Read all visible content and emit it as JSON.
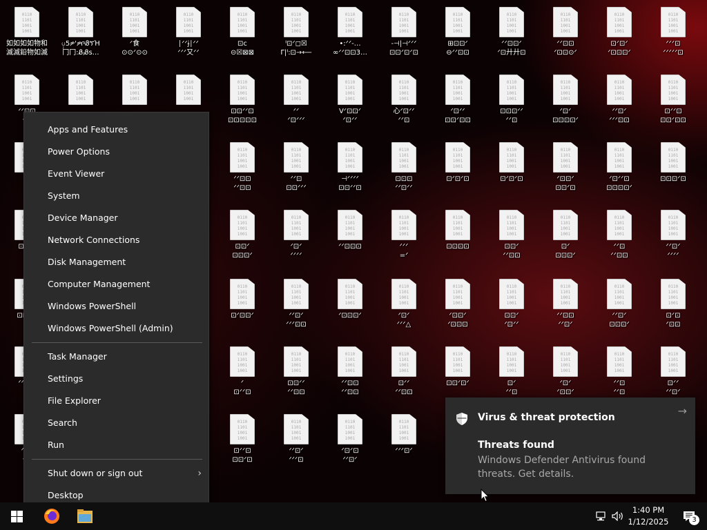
{
  "desktop": {
    "file_glyph": "0110\n1101\n1001\n1001",
    "icons": [
      [
        "如如如如物和\n滅滅鉛物如滅",
        "ၦ5ዎ'ዎቦᏰኘΉ\n冂冂:ᏰⱼᏰs…",
        "ᐟ食\n⊙⊙ᐟ⊙⊙",
        "∣ᐟᐟɉ∣ᐟᐟ\nᐟᐟᐟ又ᐟᐟ",
        "⊡c\n⊝☒⊠⊠",
        "ᑊ⊡ᐟ◻☒\nΓ|ᑊ:⊡→⟵",
        "•:ᐟᐟ-…\n∞ᐟᐟ⊡⊡3…",
        "-⊣|⊣ᐟᐟᐟ\n⊡⊡ᐟ⊡ᐟ⊡",
        "⊞⊡⊡ᐟ\n⊖ᐟᐟ⊡⊡",
        "ᐟᐟ⊡⊡ᐟ\nᐟ⊡廾廾⊡",
        "ᐟᐟ⊡⊡\nᐟ⊡⊡⊙ᐟ",
        "⊡ᐟ⊡ᐟ\nᐟ⊡⊡⊡ᐟ",
        "ᐟᐟᐟ⊡\nᐟᐟᐟᐟᐟ⊡"
      ],
      [
        "ᐟᐟ⊡⊡\nᐟᐟᐟ",
        "",
        "",
        "",
        "⊡⊡ᐟᐟ⊡\n⊡⊡⊡⊡⊡",
        "ᐟᐟ\nᐟ⊡ᐟᐟᐟ",
        "Vᐟ⊡⊡ᐟ\nᐟ⊡ᐟᐟ",
        "心ᐟ⊡ᐟᐟ\nᐟᐟ⊡",
        "ᐟ⊡ᐟᐟ\n⊡⊡ᐟ⊡⊡",
        "⊡⊡⊡ᐟᐟ\nᐟᐟ⊡",
        "ᐟ⊡ᐟ\n⊡⊡⊡⊡ᐟ",
        "ᐟᐟ⊡ᐟ\nᐟᐟᐟ⊡⊡",
        "⊡ᐟᐟ⊡\n⊡⊡ᐟ⊡⊡"
      ],
      [
        "ᐟᐟ\nᐟᐟ",
        "",
        "",
        "",
        "ᐟᐟ⊡⊡\nᐟᐟ⊡⊡",
        "ᐟᐟ⊡\n⊡⊡ᐟᐟᐟ",
        "⊣ᐟᐟᐟᐟ\n⊡⊡ᐟᐟ⊡",
        "⊡⊡⊡\nᐟᐟ⊡ᐟᐟ",
        "⊡ᐟ⊡ᐟ⊡",
        "⊡ᐟ⊡ᐟ⊡",
        "ᐟ⊡⊡ᐟ\n⊡⊡ᐟ⊡",
        "ᐟ⊡ᐟᐟ⊡\n⊡⊡⊡⊡ᐟ",
        "⊡⊡⊡ᐟ⊡"
      ],
      [
        "⊡⊡⊡",
        "",
        "",
        "",
        "⊡⊡ᐟ\n⊡⊡⊡ᐟ",
        "ᐟ⊡ᐟ\nᐟᐟᐟᐟ",
        "ᐟᐟ⊡⊡⊡\n",
        "ᐟᐟᐟ\n=ᐟ",
        "⊡⊡⊡⊡",
        "⊡⊡ᐟ\nᐟᐟ⊡⊡",
        "⊡ᐟ\n⊡⊡⊡ᐟ",
        "ᐟᐟ⊡\nᐟᐟ⊡⊡",
        "ᐟᐟ⊡ᐟ\nᐟᐟᐟᐟ"
      ],
      [
        "⊡⊡⊡ᐟ\nᐟᐟ",
        "",
        "",
        "",
        "⊡ᐟ⊡⊡ᐟ",
        "ᐟᐟ⊡ᐟ\nᐟᐟᐟ⊡⊡",
        "ᐟ⊡⊡⊡ᐟ",
        "ᐟ⊡ᐟ\nᐟᐟᐟ△",
        "ᐟ⊡⊡ᐟ\nᐟ⊡⊡⊡",
        "⊡⊡ᐟ\nᐟ⊡ᐟᐟ",
        "ᐟᐟ⊡⊡\nᐟᐟ⊡ᐟ",
        "ᐟᐟ⊡ᐟ\n⊡⊡⊡ᐟ",
        "⊡ᐟ⊡\nᐟ⊡⊡"
      ],
      [
        "ᐟᐟ⊡⊡\nᐟᐟ",
        "",
        "",
        "",
        "ᐟ\n⊡ᐟᐟ⊡",
        "⊡⊡ᐟᐟ\nᐟᐟ⊡⊡",
        "ᐟᐟ⊡⊡\nᐟᐟ⊡⊡",
        "⊡ᐟᐟ\nᐟᐟ⊡⊡",
        "⊡⊡ᐟ⊡ᐟ",
        "⊡ᐟ\nᐟᐟ⊡",
        "ᐟ⊡ᐟ\nᐟ⊡⊡ᐟ",
        "ᐟᐟ⊡\nᐟᐟ⊡",
        "⊡ᐟᐟ\nᐟᐟ⊡ᐟ"
      ],
      [
        "ᐟᐟ⊡\nᐟ⊡",
        "",
        "",
        "",
        "⊡ᐟᐟ⊡\n⊡⊡ᐟ⊡",
        "ᐟᐟ⊡ᐟ\nᐟᐟᐟ⊡",
        "ᐟ⊡ᐟ⊡\nᐟᐟ⊡ᐟ",
        "ᐟᐟᐟ⊡ᐟ"
      ]
    ]
  },
  "context_menu": {
    "group1": [
      "Apps and Features",
      "Power Options",
      "Event Viewer",
      "System",
      "Device Manager",
      "Network Connections",
      "Disk Management",
      "Computer Management",
      "Windows PowerShell",
      "Windows PowerShell (Admin)"
    ],
    "group2": [
      "Task Manager",
      "Settings",
      "File Explorer",
      "Search",
      "Run"
    ],
    "group3": [
      "Shut down or sign out",
      "Desktop"
    ],
    "submenu_chevron": "›"
  },
  "notification": {
    "app_name": "Virus & threat protection",
    "arrow": "→",
    "title": "Threats found",
    "body": "Windows Defender Antivirus found threats. Get details."
  },
  "taskbar": {
    "time": "1:40 PM",
    "date": "1/12/2025",
    "notification_count": "3"
  }
}
